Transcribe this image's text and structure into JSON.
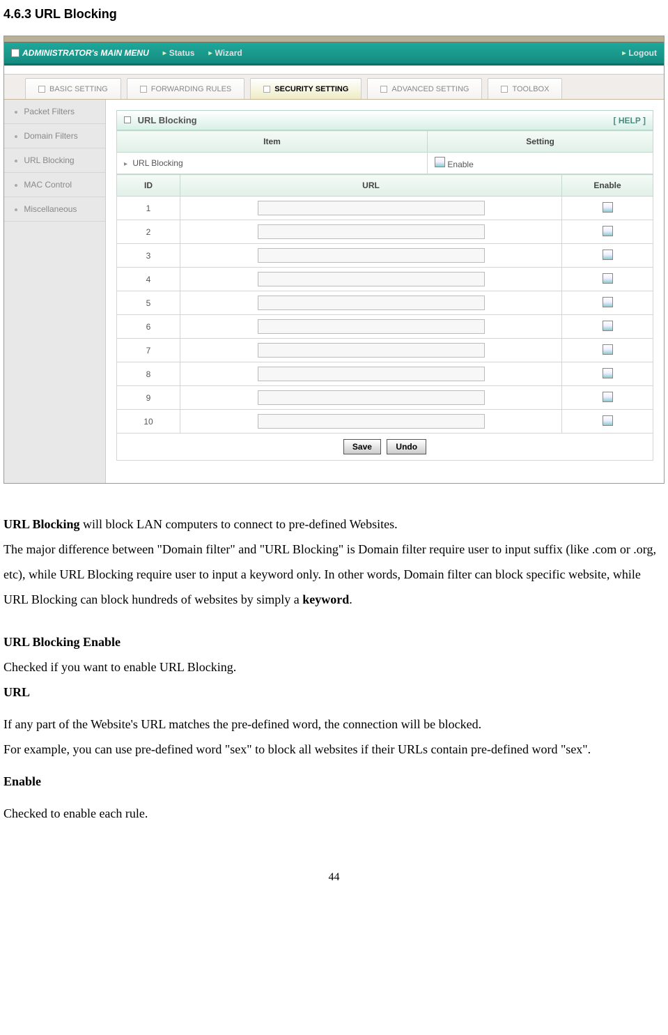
{
  "heading": "4.6.3 URL Blocking",
  "topmenu": {
    "title": "ADMINISTRATOR's MAIN MENU",
    "status": "Status",
    "wizard": "Wizard",
    "logout": "Logout"
  },
  "tabs": {
    "basic": "BASIC SETTING",
    "forwarding": "FORWARDING RULES",
    "security": "SECURITY SETTING",
    "advanced": "ADVANCED SETTING",
    "toolbox": "TOOLBOX"
  },
  "sidebar": {
    "packet": "Packet Filters",
    "domain": "Domain Filters",
    "url": "URL Blocking",
    "mac": "MAC Control",
    "misc": "Miscellaneous"
  },
  "panel": {
    "title": "URL Blocking",
    "help": "[ HELP ]",
    "item_header": "Item",
    "setting_header": "Setting",
    "url_blocking_label": "URL Blocking",
    "enable_text": "Enable",
    "id_header": "ID",
    "url_header": "URL",
    "enable_header": "Enable",
    "rows": [
      "1",
      "2",
      "3",
      "4",
      "5",
      "6",
      "7",
      "8",
      "9",
      "10"
    ],
    "save": "Save",
    "undo": "Undo"
  },
  "doc": {
    "p1_bold": "URL Blocking",
    "p1_rest": " will block LAN computers to connect to pre-defined Websites.",
    "p2": "The major difference between \"Domain filter\" and \"URL Blocking\" is Domain filter require user to input suffix (like .com or .org, etc), while URL Blocking require user to input a keyword only. In other words, Domain filter can block specific website, while URL Blocking can block hundreds of websites by simply a ",
    "p2_bold": "keyword",
    "p2_end": ".",
    "h_enable": "URL Blocking Enable",
    "p3": "Checked if you want to enable URL Blocking.",
    "h_url": "URL",
    "p4": "If any part of the Website's URL matches the pre-defined word, the connection will be blocked.",
    "p5": "For example, you can use pre-defined word \"sex\" to block all websites if their URLs contain pre-defined word \"sex\".",
    "h_enable2": "Enable",
    "p6": "Checked to enable each rule.",
    "pagenum": "44"
  }
}
